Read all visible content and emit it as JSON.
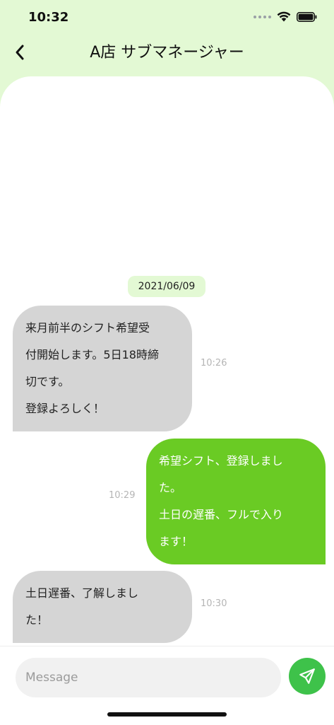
{
  "status_bar": {
    "time": "10:32",
    "icons": [
      "signal-dots-icon",
      "wifi-icon",
      "battery-icon"
    ]
  },
  "header": {
    "title": "A店 サブマネージャー",
    "back_icon": "chevron-left-icon"
  },
  "chat": {
    "date": "2021/06/09",
    "messages": [
      {
        "direction": "received",
        "text": "来月前半のシフト希望受\n付開始します。5日18時締\n切です。\n登録よろしく！",
        "time": "10:26"
      },
      {
        "direction": "sent",
        "text": "希望シフト、登録しまし\nた。\n土日の遅番、フルで入り\nます！",
        "time": "10:29"
      },
      {
        "direction": "received",
        "text": "土日遅番、了解しまし\nた！",
        "time": "10:30"
      }
    ]
  },
  "input": {
    "placeholder": "Message",
    "value": "",
    "send_icon": "paper-plane-icon"
  },
  "colors": {
    "background": "#e3f9d4",
    "sent_bubble": "#6acb24",
    "received_bubble": "#d5d5d5",
    "send_button": "#3ec24a",
    "timestamp": "#b5b5b5"
  }
}
